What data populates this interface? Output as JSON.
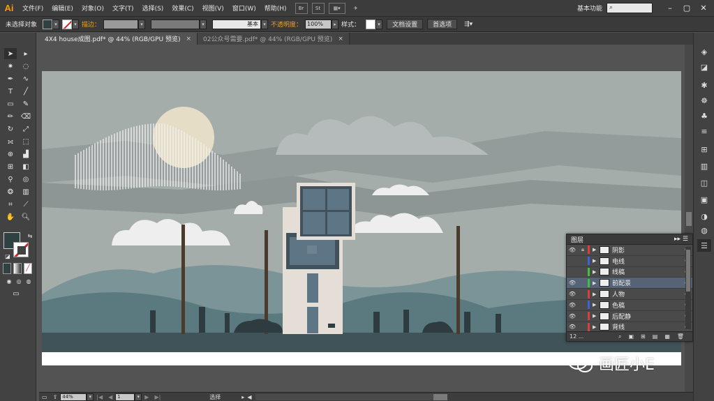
{
  "app": {
    "logo": "Ai"
  },
  "menu": [
    "文件(F)",
    "编辑(E)",
    "对象(O)",
    "文字(T)",
    "选择(S)",
    "效果(C)",
    "视图(V)",
    "窗口(W)",
    "帮助(H)"
  ],
  "menu_icons": [
    "Br",
    "St"
  ],
  "workspace": "基本功能",
  "window_controls": [
    "–",
    "▢",
    "✕"
  ],
  "controlbar": {
    "selection": "未选择对象",
    "stroke_label": "描边：",
    "brush_label": "基本",
    "opacity_label": "不透明度：",
    "opacity_value": "100%",
    "style_label": "样式：",
    "doc_settings": "文档设置",
    "preferences": "首选项"
  },
  "tabs": [
    {
      "label": "4X4 house成图.pdf* @ 44% (RGB/GPU 预览)",
      "close": "×"
    },
    {
      "label": "02公众号需要.pdf* @ 44% (RGB/GPU 预览)",
      "close": "×"
    }
  ],
  "layers_panel": {
    "title": "图层",
    "layers": [
      {
        "name": "阴影",
        "color": "#d84040",
        "visible": true,
        "locked": true
      },
      {
        "name": "电线",
        "color": "#4060e0",
        "visible": false,
        "locked": false
      },
      {
        "name": "线稿",
        "color": "#40c040",
        "visible": false,
        "locked": false
      },
      {
        "name": "前配景",
        "color": "#40c040",
        "visible": true,
        "locked": false,
        "selected": true
      },
      {
        "name": "人物",
        "color": "#d84040",
        "visible": true,
        "locked": false
      },
      {
        "name": "色稿",
        "color": "#4060e0",
        "visible": true,
        "locked": false
      },
      {
        "name": "后配静",
        "color": "#d84040",
        "visible": true,
        "locked": false
      },
      {
        "name": "背线",
        "color": "#d84040",
        "visible": true,
        "locked": false
      }
    ],
    "count": "12 ..."
  },
  "statusbar": {
    "zoom": "44%",
    "page": "1",
    "mode": "选择"
  },
  "watermark": "画匠小E",
  "colors": {
    "sky": "#a5adab",
    "moon": "#e6ddc6",
    "mountain_dark": "#5b7a80",
    "mountain_light": "#7a9498",
    "ground": "#3f5358",
    "building": "#e4ded6",
    "window": "#5d7585",
    "pole": "#4a3b2c"
  }
}
